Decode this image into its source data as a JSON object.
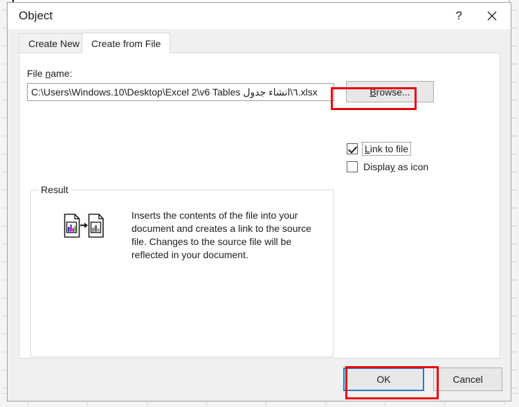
{
  "dialog": {
    "title": "Object",
    "help_button": "?",
    "close_button_name": "close-icon"
  },
  "tabs": [
    {
      "label": "Create New",
      "active": false
    },
    {
      "label": "Create from File",
      "active": true
    }
  ],
  "file_section": {
    "label_prefix": "File ",
    "label_underlined": "n",
    "label_suffix": "ame:",
    "full_label": "File name:",
    "value": "C:\\Users\\Windows.10\\Desktop\\Excel 2\\v6 Tables ٦\\انشاء جدول.xlsx",
    "placeholder": "",
    "browse_prefix": "",
    "browse_underlined": "B",
    "browse_suffix": "rowse...",
    "browse_label": "Browse..."
  },
  "options": {
    "link_to_file": {
      "label": "Link to file",
      "label_prefix": "",
      "label_underlined": "L",
      "label_suffix": "ink to file",
      "checked": true,
      "focused": true
    },
    "display_as_icon": {
      "label": "Display as icon",
      "label_prefix": "Displa",
      "label_underlined": "y",
      "label_suffix": " as icon",
      "checked": false,
      "focused": false
    }
  },
  "result": {
    "group_label": "Result",
    "description": "Inserts the contents of the file into your document and creates a link to the source file. Changes to the source file will be reflected in your document.",
    "icon_name": "linked-file-chart-icon"
  },
  "footer": {
    "ok_label": "OK",
    "cancel_label": "Cancel"
  },
  "annotations": {
    "highlight_color": "#e8000d",
    "focus_color": "#2a7ac0",
    "boxes": [
      "link-to-file",
      "ok-button"
    ]
  }
}
